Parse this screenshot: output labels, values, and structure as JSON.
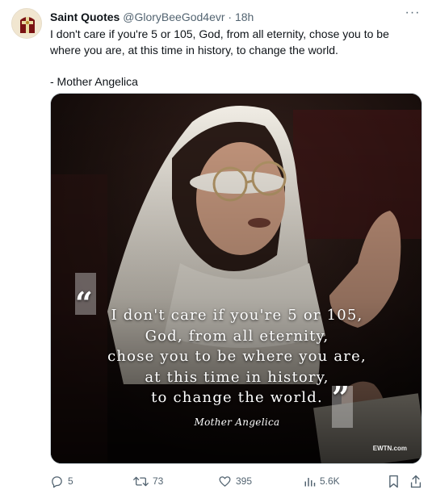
{
  "author": {
    "name": "Saint Quotes",
    "handle": "@GloryBeeGod4evr",
    "separator": "·",
    "time": "18h",
    "more_glyph": "···"
  },
  "tweet": {
    "text": "I don't care if you're 5 or 105, God, from all eternity, chose you to be where you are, at this time in history, to change the world.",
    "attribution": "- Mother Angelica"
  },
  "media": {
    "quote_lines": [
      "I don't care if you're 5 or 105,",
      "God, from all eternity,",
      "chose you to be where you are,",
      "at this time in history,",
      "to change the world."
    ],
    "open_quote": "“",
    "close_quote": "”",
    "author": "Mother Angelica",
    "watermark": "EWTN.com"
  },
  "actions": {
    "replies": "5",
    "reposts": "73",
    "likes": "395",
    "views": "5.6K"
  },
  "colors": {
    "text": "#0f1419",
    "secondary": "#536471",
    "border": "#cfd9de",
    "photo_background": "#1a0f0c"
  },
  "icons": [
    "reply-icon",
    "repost-icon",
    "like-icon",
    "views-icon",
    "bookmark-icon",
    "share-icon",
    "more-icon"
  ]
}
